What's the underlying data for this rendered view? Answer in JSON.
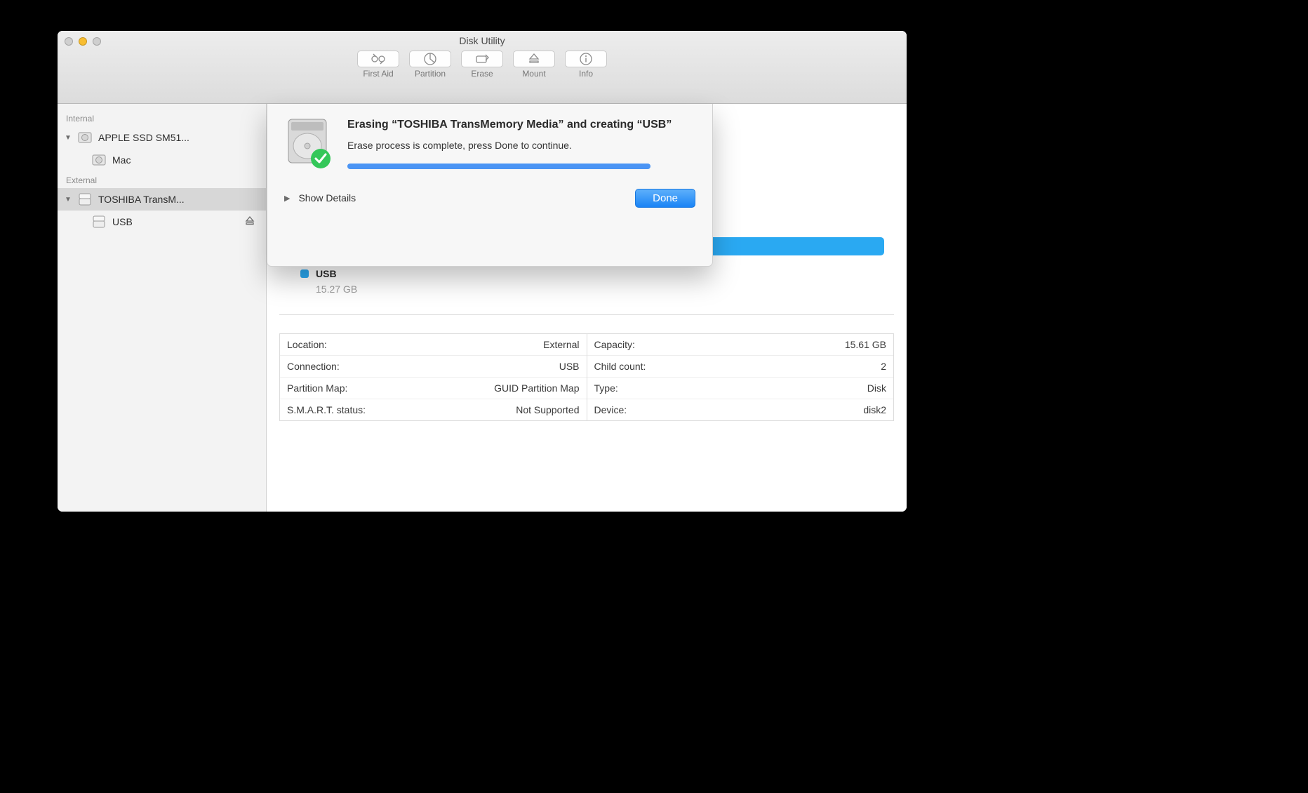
{
  "window": {
    "title": "Disk Utility"
  },
  "toolbar": {
    "first_aid": "First Aid",
    "partition": "Partition",
    "erase": "Erase",
    "mount": "Mount",
    "info": "Info"
  },
  "sidebar": {
    "sections": {
      "internal_title": "Internal",
      "external_title": "External"
    },
    "internal": [
      {
        "label": "APPLE SSD SM51..."
      },
      {
        "label": "Mac"
      }
    ],
    "external": [
      {
        "label": "TOSHIBA TransM..."
      },
      {
        "label": "USB"
      }
    ]
  },
  "sheet": {
    "title_line": "Erasing “TOSHIBA TransMemory Media” and creating “USB”",
    "message": "Erase process is complete, press Done to continue.",
    "show_details_label": "Show Details",
    "done_label": "Done"
  },
  "volume": {
    "name": "USB",
    "size": "15.27 GB"
  },
  "details": {
    "left": [
      {
        "k": "Location:",
        "v": "External"
      },
      {
        "k": "Connection:",
        "v": "USB"
      },
      {
        "k": "Partition Map:",
        "v": "GUID Partition Map"
      },
      {
        "k": "S.M.A.R.T. status:",
        "v": "Not Supported"
      }
    ],
    "right": [
      {
        "k": "Capacity:",
        "v": "15.61 GB"
      },
      {
        "k": "Child count:",
        "v": "2"
      },
      {
        "k": "Type:",
        "v": "Disk"
      },
      {
        "k": "Device:",
        "v": "disk2"
      }
    ]
  }
}
